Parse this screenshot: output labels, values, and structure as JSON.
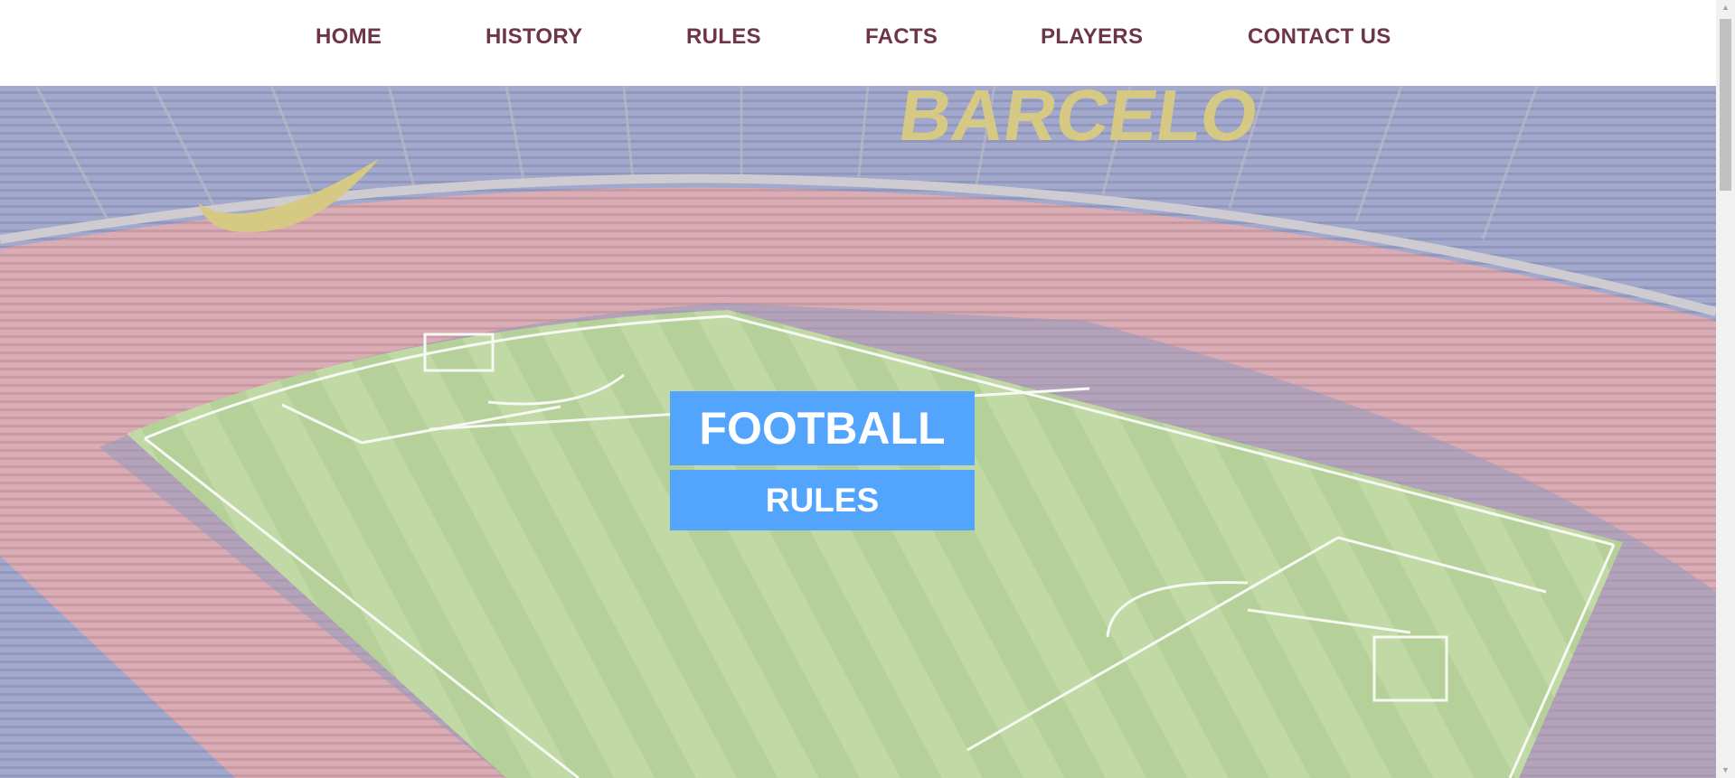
{
  "nav": {
    "items": [
      {
        "label": "HOME"
      },
      {
        "label": "HISTORY"
      },
      {
        "label": "RULES"
      },
      {
        "label": "FACTS"
      },
      {
        "label": "PLAYERS"
      },
      {
        "label": "CONTACT US"
      }
    ]
  },
  "hero": {
    "title": "FOOTBALL",
    "subtitle": "RULES",
    "stadium_sign": "BARCELO"
  },
  "colors": {
    "nav_text": "#6e3548",
    "title_bg": "#52a4fd",
    "pitch": "#9cc070",
    "seats_red": "#c47a87",
    "seats_blue": "#6f78b0"
  }
}
